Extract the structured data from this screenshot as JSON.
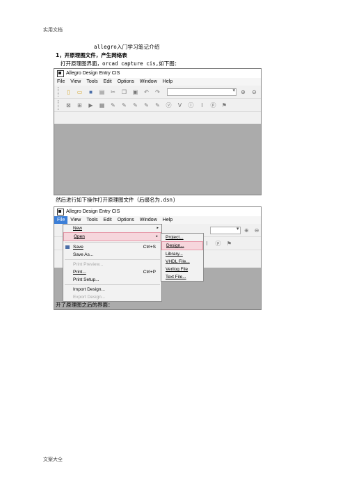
{
  "page": {
    "header": "实用文档",
    "footer": "文案大全",
    "title": "allegro入门学习笔记介绍",
    "section": "1，开原理图文件，产生网络表",
    "line1": "打开原理图界面，orcad capture cis,如下图：",
    "line2": "然后进行如下操作打开原理图文件（后缀名为.dsn)",
    "line3": "开了原理图之后的界面："
  },
  "app": {
    "title": "Allegro Design Entry CIS",
    "menu": [
      "File",
      "View",
      "Tools",
      "Edit",
      "Options",
      "Window",
      "Help"
    ]
  },
  "file_menu": [
    {
      "label": "New",
      "arrow": "▸"
    },
    {
      "label": "Open",
      "arrow": "▸"
    },
    {
      "label": "Save",
      "accel": "Ctrl+S"
    },
    {
      "label": "Save As..."
    },
    {
      "label": "Print Preview..."
    },
    {
      "label": "Print...",
      "accel": "Ctrl+P"
    },
    {
      "label": "Print Setup..."
    },
    {
      "label": "Import Design..."
    },
    {
      "label": "Export Design..."
    }
  ],
  "open_submenu": [
    "Project...",
    "Design...",
    "Library...",
    "VHDL File...",
    "Verilog File",
    "Text File..."
  ],
  "colors": {
    "menu_highlight": "#f6d6dc",
    "menu_selected": "#3c7fd8",
    "client_area": "#ababab"
  },
  "icons": [
    "new-icon",
    "open-icon",
    "save-icon",
    "print-icon",
    "cut-icon",
    "copy-icon",
    "paste-icon",
    "undo-icon",
    "redo-icon",
    "zoom-in-icon",
    "zoom-out-icon"
  ]
}
